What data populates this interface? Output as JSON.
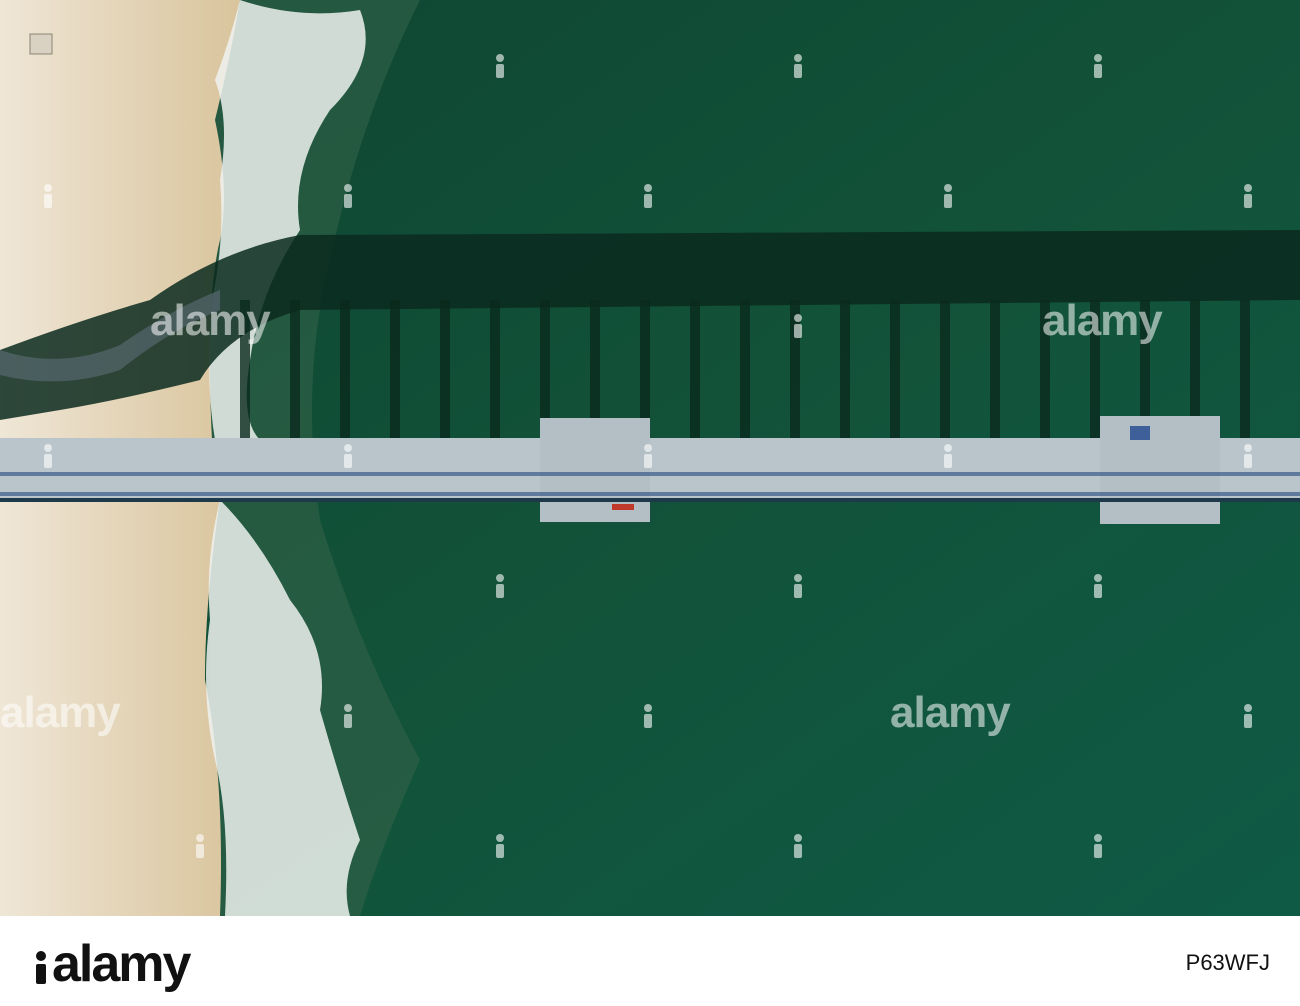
{
  "photo": {
    "watermark_text": "alamy",
    "colors": {
      "sea": "#0f4a34",
      "sand": "#e8dcc6",
      "pier": "#b9c5cb",
      "shadow": "#0a2a1e",
      "foam": "#f2f5f4"
    }
  },
  "footer": {
    "brand": "alamy",
    "image_id": "P63WFJ"
  }
}
